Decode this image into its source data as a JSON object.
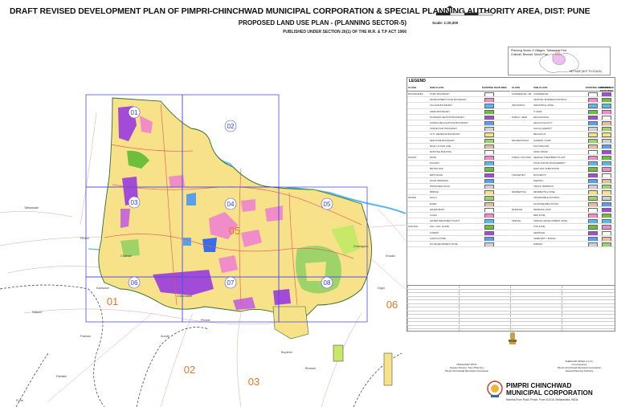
{
  "header": {
    "title": "DRAFT REVISED DEVELOPMENT PLAN OF PIMPRI-CHINCHWAD MUNICIPAL CORPORATION & SPECIAL PLANNING AUTHORITY AREA, DIST: PUNE",
    "subtitle": "PROPOSED LAND USE PLAN - (PLANNING SECTOR-5)",
    "published": "PUBLISHED UNDER SECTION 26(1) OF THE M.R. & T.P ACT 1966"
  },
  "scale": {
    "label": "Scale: 1:20,000"
  },
  "key_map": {
    "heading": "Planning Sector-5 Villages: Tathawade Part, Chikhali, Bhosari, Moshi Part",
    "label": "KEY MAP (NOT TO SCALE)",
    "sector_number": "05"
  },
  "map": {
    "grid_cells": [
      "01",
      "02",
      "03",
      "04",
      "05",
      "06",
      "07",
      "08"
    ],
    "sector_numbers": [
      "01",
      "02",
      "03",
      "05",
      "06"
    ],
    "place_labels": [
      "Tathawade",
      "Dudulgaon",
      "Pimpri",
      "Kalewadi",
      "Chinchwad",
      "Chikhali",
      "Wakad",
      "Pimple",
      "Rahatni",
      "Bopkhel",
      "Dighi",
      "Bhosari",
      "Pune",
      "Aundh",
      "Pashan",
      "Khadki"
    ]
  },
  "legend": {
    "title": "LEGEND",
    "headers": {
      "class": "CLASS",
      "sub_class": "SUB CLASS",
      "existing": "EXISTING FEATURES",
      "proposed": "PROPOSED FEATURES"
    },
    "left_rows": [
      {
        "class": "BOUNDARIES",
        "sub": "PCMC BOUNDARY"
      },
      {
        "class": "",
        "sub": "DEVELOPMENT PLAN BOUNDARY"
      },
      {
        "class": "",
        "sub": "VILLAGE BOUNDARY"
      },
      {
        "class": "",
        "sub": "WARD BOUNDARY"
      },
      {
        "class": "",
        "sub": "PLANNING SECTOR BOUNDARY"
      },
      {
        "class": "",
        "sub": "ZONING REGULATIONS BOUNDARY"
      },
      {
        "class": "",
        "sub": "SURVEY/GAT BOUNDARY"
      },
      {
        "class": "",
        "sub": "CTS / REVENUE BOUNDARY"
      },
      {
        "class": "",
        "sub": "RED ZONE BOUNDARY"
      },
      {
        "class": "",
        "sub": "BLUE / FLOOD LINE"
      },
      {
        "class": "",
        "sub": "EXISTING BUILDING"
      },
      {
        "class": "ROADS",
        "sub": "ROAD"
      },
      {
        "class": "",
        "sub": "RAILWAY"
      },
      {
        "class": "",
        "sub": "METRO RAIL"
      },
      {
        "class": "",
        "sub": "BRTS ROAD"
      },
      {
        "class": "",
        "sub": "ROAD WIDENING"
      },
      {
        "class": "",
        "sub": "PROPOSED ROAD"
      },
      {
        "class": "",
        "sub": "BRIDGE"
      },
      {
        "class": "WATER",
        "sub": "NALLA"
      },
      {
        "class": "",
        "sub": "RIVER"
      },
      {
        "class": "",
        "sub": "WATER BODY"
      },
      {
        "class": "",
        "sub": "CANAL"
      },
      {
        "class": "",
        "sub": "WATER TREATMENT PLANT"
      },
      {
        "class": "NATURAL",
        "sub": "HILL / HILL SLOPE"
      },
      {
        "class": "",
        "sub": "FOREST"
      },
      {
        "class": "",
        "sub": "AGRICULTURE"
      },
      {
        "class": "",
        "sub": "NO DEVELOPMENT ZONE"
      }
    ],
    "right_rows": [
      {
        "class": "COMMERCIAL USE",
        "sub": "COMMERCIAL"
      },
      {
        "class": "",
        "sub": "CENTRAL BUSINESS DISTRICT"
      },
      {
        "class": "INDUSTRIAL",
        "sub": "INDUSTRIAL ZONE"
      },
      {
        "class": "",
        "sub": "IT PARK"
      },
      {
        "class": "PUBLIC / SEMI",
        "sub": "EDUCATIONAL"
      },
      {
        "class": "",
        "sub": "HEALTH FACILITY"
      },
      {
        "class": "",
        "sub": "SOCIAL AMENITY"
      },
      {
        "class": "",
        "sub": "RELIGIOUS"
      },
      {
        "class": "RECREATIONAL",
        "sub": "GARDEN / PARK"
      },
      {
        "class": "",
        "sub": "PLAYGROUND"
      },
      {
        "class": "",
        "sub": "OPEN SPACE"
      },
      {
        "class": "PUBLIC UTILITIES",
        "sub": "SEWAGE TREATMENT PLANT"
      },
      {
        "class": "",
        "sub": "SOLID WASTE MANAGEMENT"
      },
      {
        "class": "",
        "sub": "ELECTRIC SUBSTATION"
      },
      {
        "class": "TRANSPORT",
        "sub": "BUS DEPOT"
      },
      {
        "class": "",
        "sub": "PARKING"
      },
      {
        "class": "",
        "sub": "TRUCK TERMINUS"
      },
      {
        "class": "RESIDENTIAL",
        "sub": "RESIDENTIAL ZONE"
      },
      {
        "class": "",
        "sub": "AFFORDABLE HOUSING"
      },
      {
        "class": "",
        "sub": "SLUM REHABILITATION"
      },
      {
        "class": "DEFENCE",
        "sub": "DEFENCE LAND"
      },
      {
        "class": "",
        "sub": "RED ZONE"
      },
      {
        "class": "SPECIAL",
        "sub": "SPECIAL DEVELOPMENT ZONE"
      },
      {
        "class": "",
        "sub": "TOD ZONE"
      },
      {
        "class": "",
        "sub": "HERITAGE"
      },
      {
        "class": "",
        "sub": "CEMETERY / BURIAL"
      },
      {
        "class": "",
        "sub": "MARKET"
      }
    ]
  },
  "signatures": {
    "left": [
      "PRASHANT PATIL",
      "Deputy Director, Town Planning",
      "Pimpri-Chinchwad Municipal Corporation"
    ],
    "right": [
      "SHEKHAR SINGH (I.A.S.)",
      "Commissioner",
      "Pimpri-Chinchwad Municipal Corporation",
      "Special Planning Authority"
    ]
  },
  "corporation": {
    "name_line1": "PIMPRI CHINCHWAD",
    "name_line2": "MUNICIPAL CORPORATION",
    "address": "Mumbai-Pune Road, Pimpri, Pune 411018, Maharashtra, INDIA"
  },
  "colors": {
    "residential": "#f7e28a",
    "commercial": "#5aa0e8",
    "industrial": "#a24bd6",
    "public": "#f08cc8",
    "green": "#9ed36a",
    "river": "#5cb8e8",
    "boundary": "#4f4fe0",
    "sector_label": "#e0772a",
    "ward_label": "#3a3ad0"
  }
}
